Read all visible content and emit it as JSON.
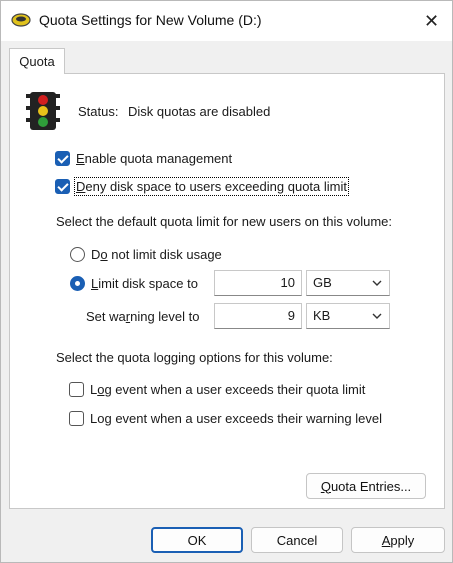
{
  "window": {
    "title": "Quota Settings for New Volume (D:)",
    "close_glyph": "✕"
  },
  "tabs": [
    {
      "label": "Quota",
      "active": true
    }
  ],
  "status": {
    "label": "Status:",
    "value": "Disk quotas are disabled"
  },
  "options": {
    "enable_quota": {
      "label_u": "E",
      "label_rest": "nable quota management",
      "checked": true
    },
    "deny_space": {
      "label_u": "D",
      "label_rest": "eny disk space to users exceeding quota limit",
      "checked": true
    }
  },
  "default_limit": {
    "heading": "Select the default quota limit for new users on this volume:",
    "no_limit": {
      "pre": "D",
      "u": "o",
      "rest": " not limit disk usage",
      "selected": false
    },
    "limit": {
      "u": "L",
      "rest": "imit disk space to",
      "selected": true,
      "value": "10",
      "unit": "GB"
    },
    "warning": {
      "pre": "Set wa",
      "u": "r",
      "rest": "ning level to",
      "value": "9",
      "unit": "KB"
    }
  },
  "logging": {
    "heading": "Select the quota logging options for this volume:",
    "exceed_quota": {
      "pre": "L",
      "u": "o",
      "rest": "g event when a user exceeds their quota limit",
      "checked": false
    },
    "exceed_warning": {
      "pre": "Lo",
      "u": "g",
      "rest": " event when a user exceeds their warning level",
      "checked": false
    }
  },
  "quota_entries": {
    "u": "Q",
    "rest": "uota Entries..."
  },
  "buttons": {
    "ok": "OK",
    "cancel": "Cancel",
    "apply_u": "A",
    "apply_rest": "pply"
  },
  "colors": {
    "accent": "#1a5fb4",
    "traffic_red": "#d21f1f",
    "traffic_yellow": "#e8c21a",
    "traffic_green": "#2f9e3a"
  }
}
